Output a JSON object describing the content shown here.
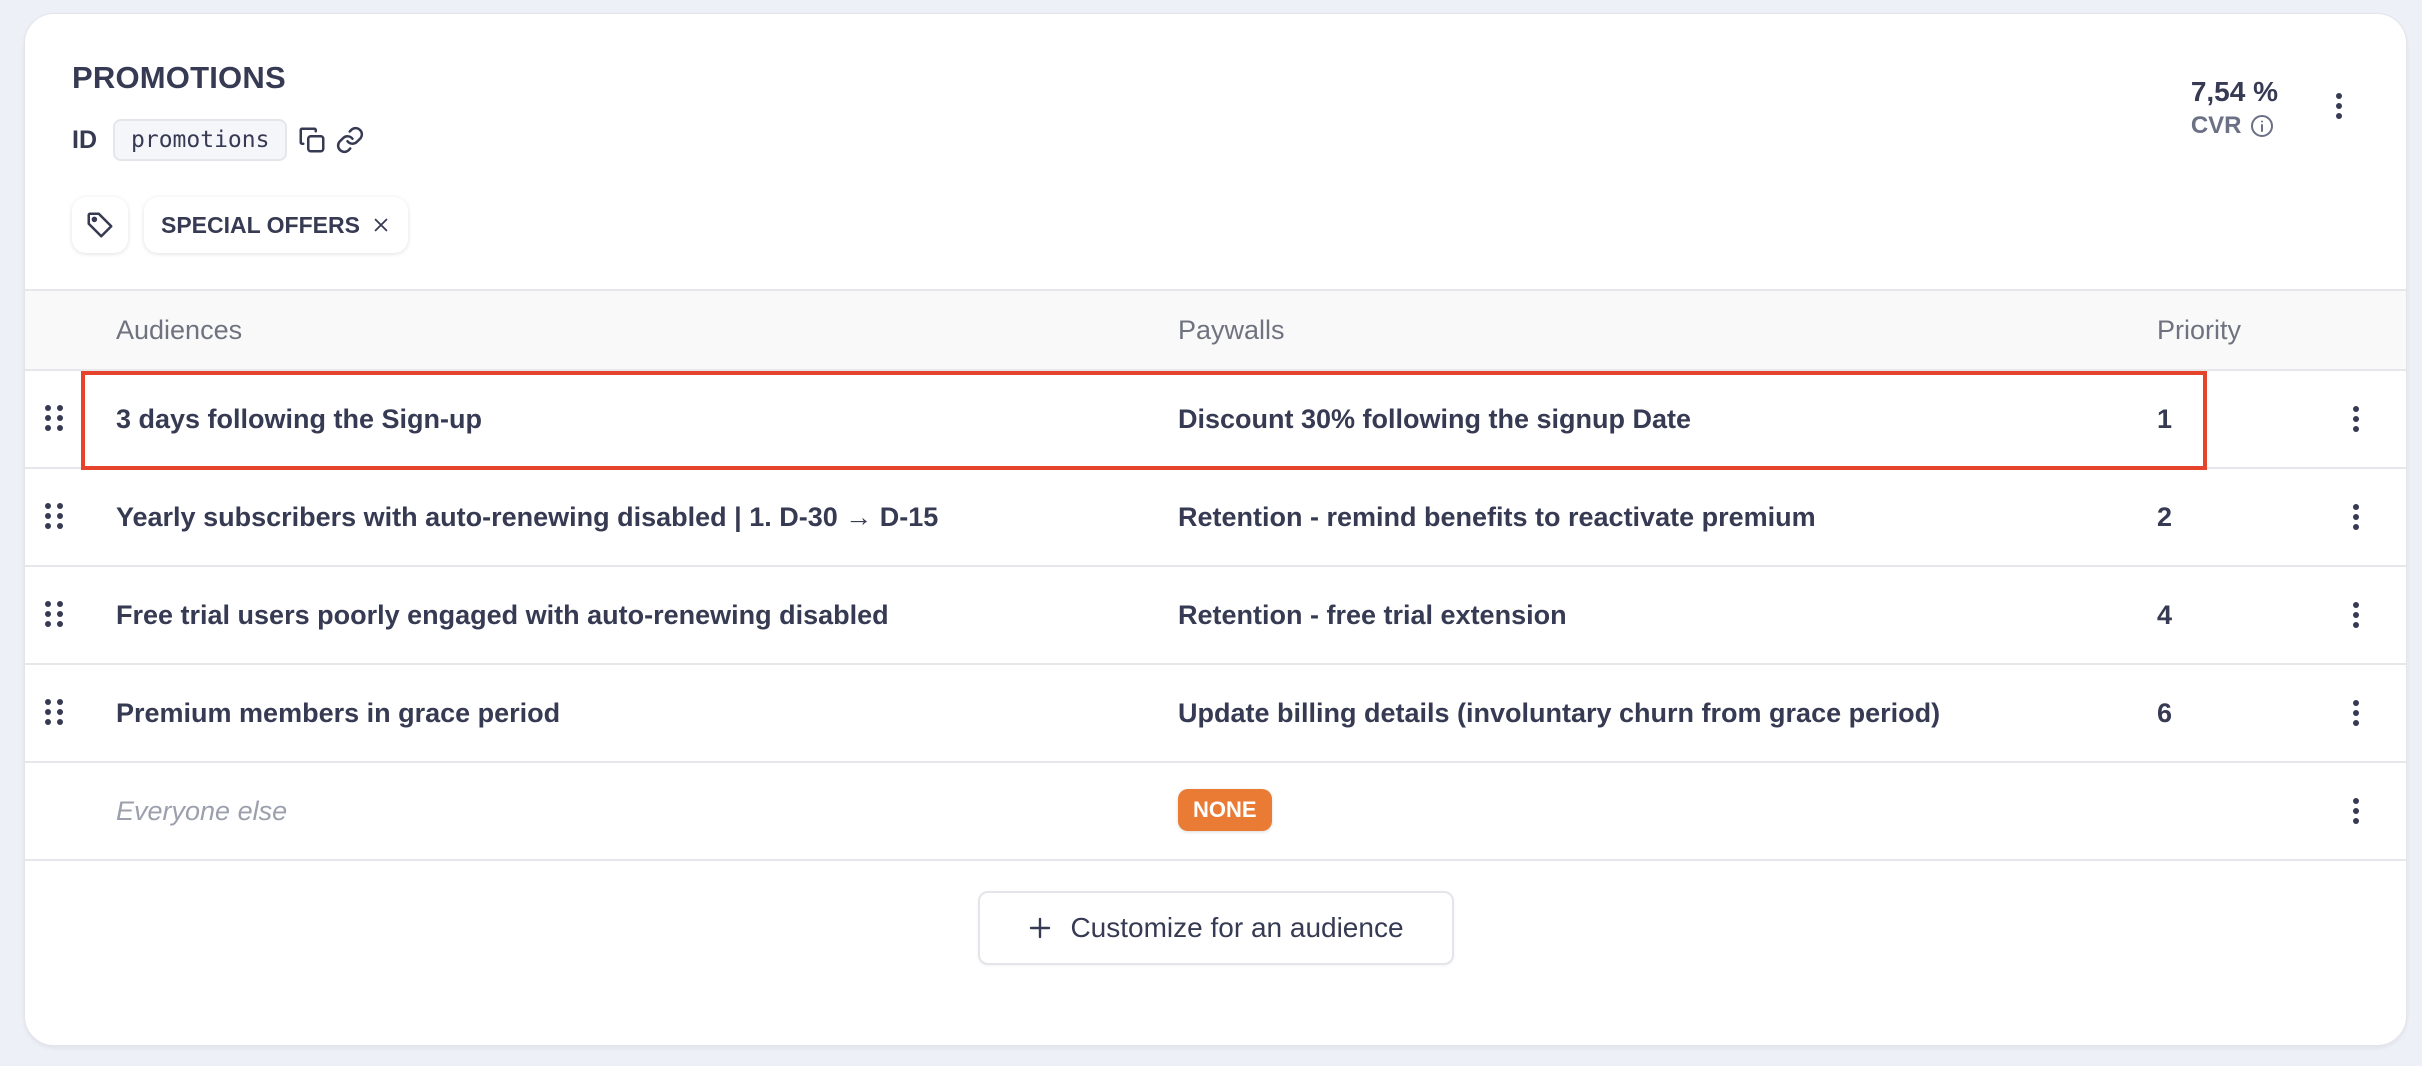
{
  "card": {
    "title": "PROMOTIONS",
    "id_label": "ID",
    "id_value": "promotions",
    "tags": [
      {
        "label": "SPECIAL OFFERS"
      }
    ],
    "metric": {
      "value": "7,54 %",
      "label": "CVR"
    }
  },
  "table": {
    "columns": {
      "audiences": "Audiences",
      "paywalls": "Paywalls",
      "priority": "Priority"
    },
    "rows": [
      {
        "audience": "3 days following the Sign-up",
        "paywall": "Discount 30% following the signup Date",
        "priority": "1",
        "highlighted": true
      },
      {
        "audience": "Yearly subscribers with auto-renewing disabled | 1. D-30 → D-15",
        "paywall": "Retention - remind benefits to reactivate premium",
        "priority": "2"
      },
      {
        "audience": "Free trial users poorly engaged with auto-renewing disabled",
        "paywall": "Retention - free trial extension",
        "priority": "4"
      },
      {
        "audience": "Premium members in grace period",
        "paywall": "Update billing details (involuntary churn from grace period)",
        "priority": "6"
      }
    ],
    "fallback": {
      "audience": "Everyone else",
      "paywall_badge": "NONE"
    }
  },
  "actions": {
    "add_audience": "Customize for an audience"
  },
  "colors": {
    "highlight": "#e5432c",
    "none_badge": "#e97b35",
    "text": "#363a52"
  }
}
